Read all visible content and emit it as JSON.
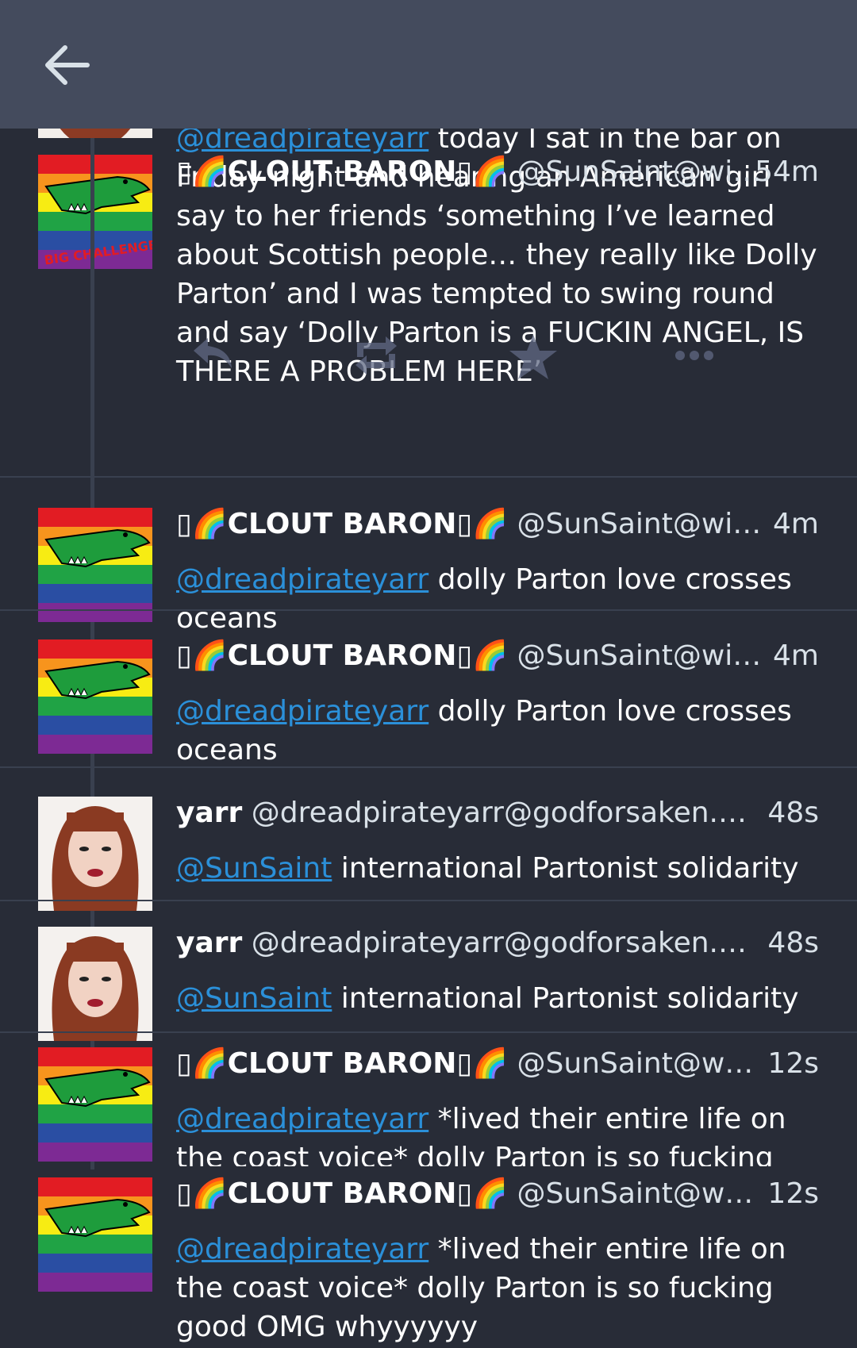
{
  "header": {
    "back_icon": "arrow-left-icon"
  },
  "statuses": [
    {
      "display_name": "▯🌈CLOUT BARON▯🌈",
      "account": "@SunSaint@wi…",
      "time": "54m",
      "mention": "@dreadpirateyarr",
      "text": " today I sat in the bar on Friday night and hearing an American girl say to her friends ‘something I’ve learned about Scottish people… they really like Dolly Parton’ and I was tempted to swing round and say ‘Dolly Parton is a FUCKIN ANGEL, IS THERE A PROBLEM HERE’",
      "avatar": "rainbow-alligator"
    },
    {
      "display_name": "▯🌈CLOUT BARON▯🌈",
      "account": "@SunSaint@wi…",
      "time": "4m",
      "mention": "@dreadpirateyarr",
      "text": " dolly Parton love crosses oceans",
      "avatar": "rainbow-alligator"
    },
    {
      "display_name": "▯🌈CLOUT BARON▯🌈",
      "account": "@SunSaint@wi…",
      "time": "4m",
      "mention": "@dreadpirateyarr",
      "text": " dolly Parton love crosses oceans",
      "avatar": "rainbow-alligator"
    },
    {
      "display_name": "yarr",
      "account": "@dreadpirateyarr@godforsaken.…",
      "time": "48s",
      "mention": "@SunSaint",
      "text": " international Partonist solidarity",
      "avatar": "woman-portrait"
    },
    {
      "display_name": "yarr",
      "account": "@dreadpirateyarr@godforsaken.…",
      "time": "48s",
      "mention": "@SunSaint",
      "text": " international Partonist solidarity",
      "avatar": "woman-portrait"
    },
    {
      "display_name": "▯🌈CLOUT BARON▯🌈",
      "account": "@SunSaint@w…",
      "time": "12s",
      "mention": "@dreadpirateyarr",
      "text": " *lived their entire life on the coast voice* dolly Parton is so fucking good OMG whyyyyyy",
      "avatar": "rainbow-alligator"
    },
    {
      "display_name": "▯🌈CLOUT BARON▯🌈",
      "account": "@SunSaint@w…",
      "time": "12s",
      "mention": "@dreadpirateyarr",
      "text": " *lived their entire life on the coast voice* dolly Parton is so fucking good OMG whyyyyyy",
      "avatar": "rainbow-alligator"
    }
  ],
  "avatar_badge": "BIG CHALLENGE",
  "action_icons": [
    "reply-icon",
    "boost-icon",
    "favourite-icon",
    "more-icon"
  ],
  "colors": {
    "background": "#282c37",
    "topbar": "#444b5d",
    "mention": "#2b90d9",
    "action_icon": "#606984"
  }
}
